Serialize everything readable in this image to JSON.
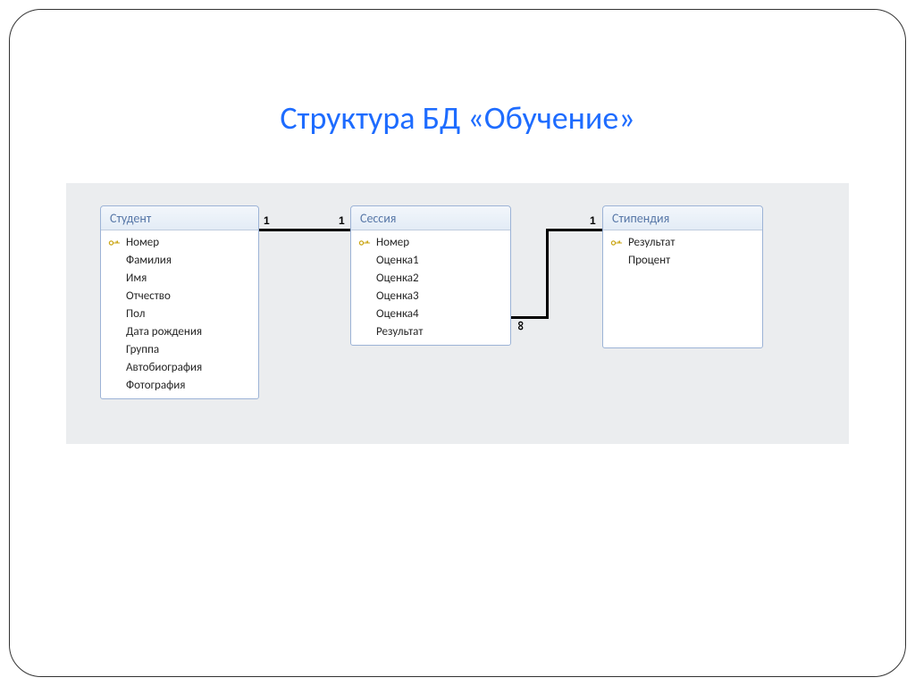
{
  "title": "Структура БД «Обучение»",
  "tables": {
    "student": {
      "title": "Студент",
      "fields": [
        {
          "name": "Номер",
          "pk": true
        },
        {
          "name": "Фамилия",
          "pk": false
        },
        {
          "name": "Имя",
          "pk": false
        },
        {
          "name": "Отчество",
          "pk": false
        },
        {
          "name": "Пол",
          "pk": false
        },
        {
          "name": "Дата рождения",
          "pk": false
        },
        {
          "name": "Группа",
          "pk": false
        },
        {
          "name": "Автобиография",
          "pk": false
        },
        {
          "name": "Фотография",
          "pk": false
        }
      ]
    },
    "session": {
      "title": "Сессия",
      "fields": [
        {
          "name": "Номер",
          "pk": true
        },
        {
          "name": "Оценка1",
          "pk": false
        },
        {
          "name": "Оценка2",
          "pk": false
        },
        {
          "name": "Оценка3",
          "pk": false
        },
        {
          "name": "Оценка4",
          "pk": false
        },
        {
          "name": "Результат",
          "pk": false
        }
      ]
    },
    "scholarship": {
      "title": "Стипендия",
      "fields": [
        {
          "name": "Результат",
          "pk": true
        },
        {
          "name": "Процент",
          "pk": false
        }
      ]
    }
  },
  "relations": {
    "r1": {
      "from": "student",
      "to": "session",
      "left_card": "1",
      "right_card": "1"
    },
    "r2": {
      "from": "session",
      "to": "scholarship",
      "left_card": "∞",
      "right_card": "1"
    }
  }
}
